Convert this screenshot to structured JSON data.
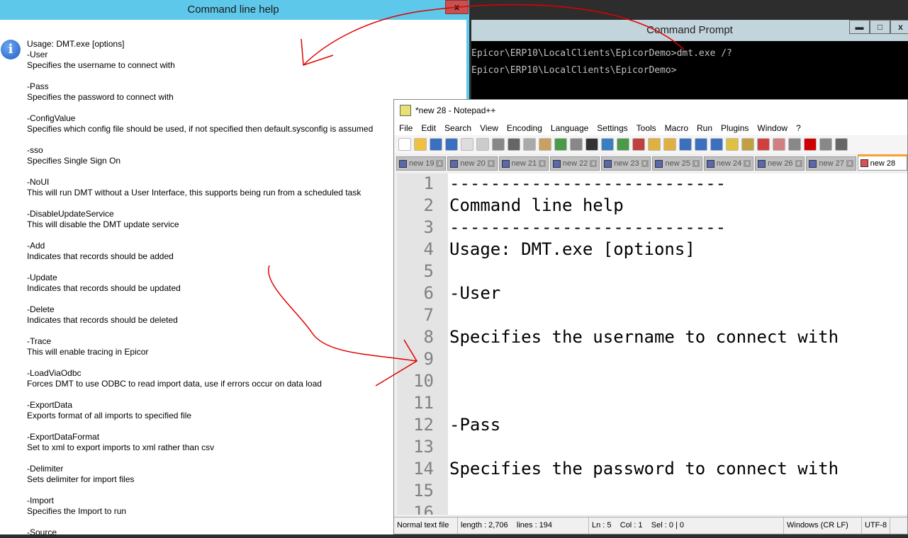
{
  "help": {
    "title": "Command line help",
    "close": "x",
    "icon": "info-icon",
    "lines": [
      "Usage: DMT.exe [options]",
      "-User",
      "Specifies the username to connect with",
      "",
      "-Pass",
      "Specifies the password to connect with",
      "",
      "-ConfigValue",
      "Specifies which config file should be used, if not specified then default.sysconfig is assumed",
      "",
      "-sso",
      "Specifies Single Sign On",
      "",
      "-NoUI",
      "This will run DMT without a User Interface, this supports being run from a scheduled task",
      "",
      "-DisableUpdateService",
      "This will disable the DMT update service",
      "",
      "-Add",
      "Indicates that records should be added",
      "",
      "-Update",
      "Indicates that records should be updated",
      "",
      "-Delete",
      "Indicates that records should be deleted",
      "",
      "-Trace",
      "This will enable tracing in Epicor",
      "",
      "-LoadViaOdbc",
      "Forces DMT to use ODBC to read import data, use if errors occur on data load",
      "",
      "-ExportData",
      "Exports format of all imports to specified file",
      "",
      "-ExportDataFormat",
      "Set to xml to export imports to xml rather than csv",
      "",
      "-Delimiter",
      "Sets delimiter for import files",
      "",
      "-Import",
      "Specifies the Import to run",
      "",
      "-Source"
    ]
  },
  "cmd": {
    "title": "Command Prompt",
    "lines": [
      "Epicor\\ERP10\\LocalClients\\EpicorDemo>dmt.exe /?",
      "Epicor\\ERP10\\LocalClients\\EpicorDemo>"
    ],
    "min": "▬",
    "max": "□",
    "close": "x"
  },
  "npp": {
    "title": "*new 28 - Notepad++",
    "menu": [
      "File",
      "Edit",
      "Search",
      "View",
      "Encoding",
      "Language",
      "Settings",
      "Tools",
      "Macro",
      "Run",
      "Plugins",
      "Window",
      "?"
    ],
    "tabs": [
      "new 19",
      "new 20",
      "new 21",
      "new 22",
      "new 23",
      "new 25",
      "new 24",
      "new 26",
      "new 27",
      "new 28"
    ],
    "editor_lines": [
      "---------------------------",
      "Command line help",
      "---------------------------",
      "Usage: DMT.exe [options]",
      "",
      "-User",
      "",
      "Specifies the username to connect with",
      "",
      "",
      "",
      "-Pass",
      "",
      "Specifies the password to connect with",
      "",
      ""
    ],
    "current_line": 5,
    "status": {
      "type": "Normal text file",
      "length": "length : 2,706    lines : 194",
      "pos": "Ln : 5    Col : 1    Sel : 0 | 0",
      "eol": "Windows (CR LF)",
      "enc": "UTF-8"
    }
  },
  "colors": {
    "annotation": "#e00000",
    "help_title": "#5ec8ea"
  }
}
